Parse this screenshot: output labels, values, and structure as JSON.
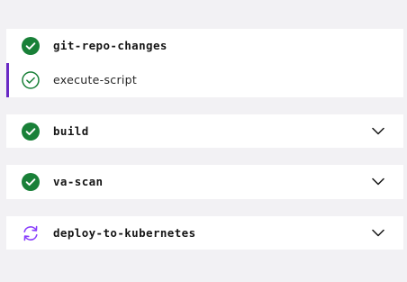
{
  "pipeline": {
    "stages": [
      {
        "label": "git-repo-changes",
        "status": "succeeded",
        "icon": "check-circle-filled-icon",
        "expandable": false
      },
      {
        "label": "execute-script",
        "status": "succeeded",
        "icon": "check-circle-outline-icon",
        "substep": true
      },
      {
        "label": "build",
        "status": "succeeded",
        "icon": "check-circle-filled-icon",
        "expandable": true
      },
      {
        "label": "va-scan",
        "status": "succeeded",
        "icon": "check-circle-filled-icon",
        "expandable": true
      },
      {
        "label": "deploy-to-kubernetes",
        "status": "running",
        "icon": "sync-icon",
        "expandable": true
      }
    ]
  },
  "colors": {
    "success": "#198038",
    "running": "#8a3ffc",
    "active_indicator": "#6929c4",
    "background": "#f2f1f4",
    "card": "#ffffff",
    "text": "#161616"
  }
}
